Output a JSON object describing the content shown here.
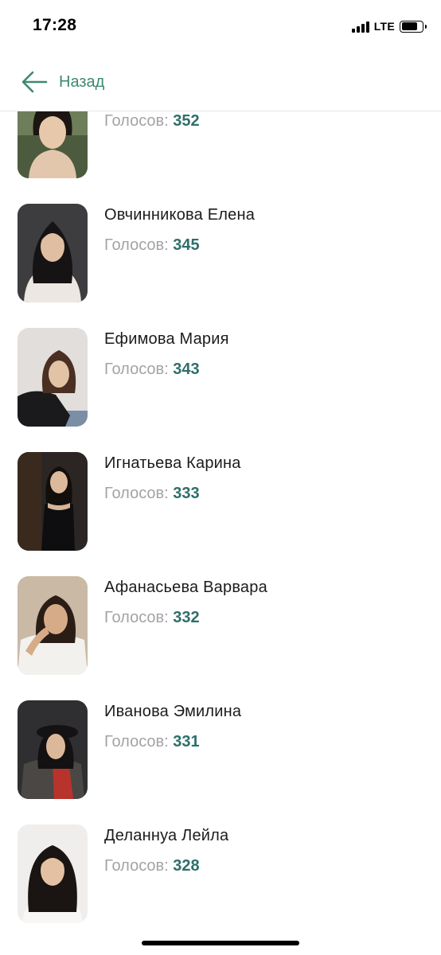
{
  "status_bar": {
    "time": "17:28",
    "network": "LTE"
  },
  "nav": {
    "back_label": "Назад"
  },
  "votes_label": "Голосов:",
  "contestants": [
    {
      "name": "",
      "votes": "352"
    },
    {
      "name": "Овчинникова Елена",
      "votes": "345"
    },
    {
      "name": "Ефимова Мария",
      "votes": "343"
    },
    {
      "name": "Игнатьева Карина",
      "votes": "333"
    },
    {
      "name": "Афанасьева Варвара",
      "votes": "332"
    },
    {
      "name": "Иванова Эмилина",
      "votes": "331"
    },
    {
      "name": "Деланнуа Лейла",
      "votes": "328"
    }
  ],
  "colors": {
    "accent": "#3d8a6c",
    "vote_count": "#2e6f6a",
    "vote_label": "#a3a3a8"
  }
}
